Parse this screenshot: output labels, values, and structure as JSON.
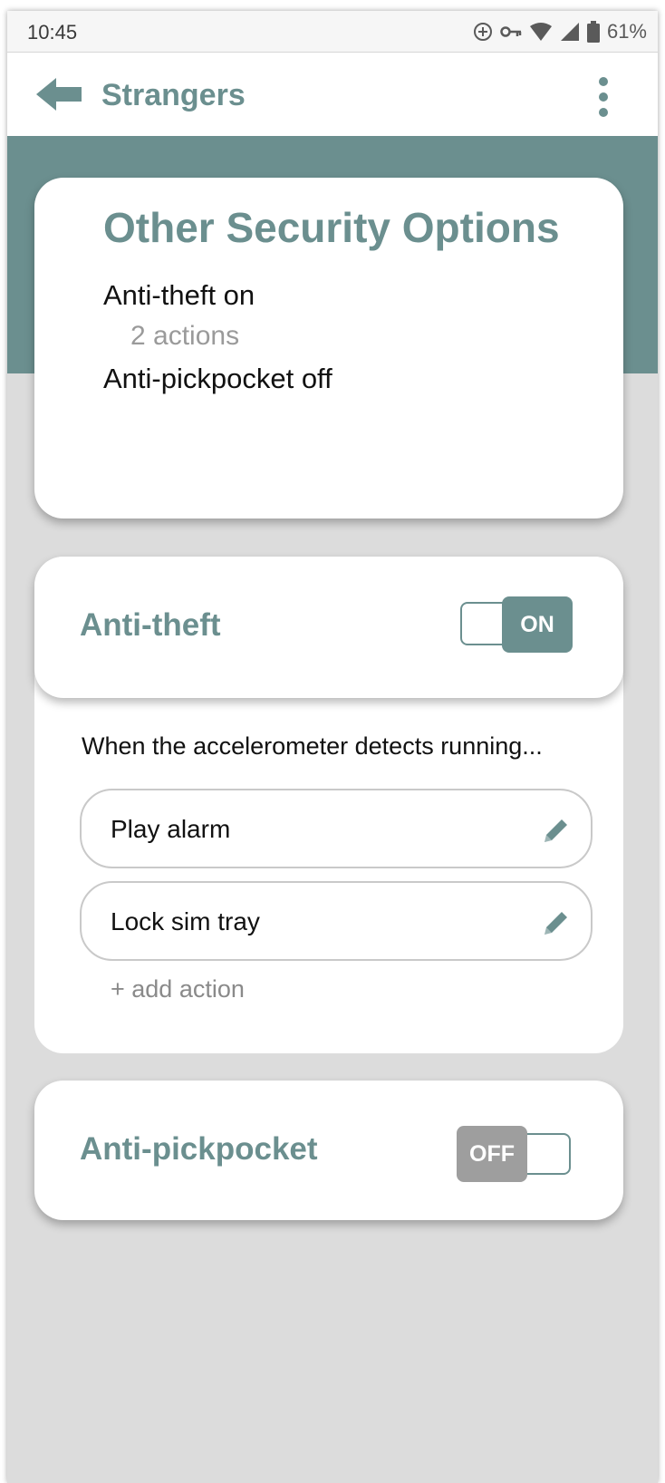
{
  "status_bar": {
    "time": "10:45",
    "battery": "61%",
    "icons": [
      "sync-icon",
      "vpn-key-icon",
      "wifi-icon",
      "cell-signal-icon",
      "battery-icon"
    ]
  },
  "app_bar": {
    "title": "Strangers",
    "back_icon": "arrow-left-icon",
    "menu_icon": "more-vert-icon"
  },
  "summary": {
    "title": "Other Security Options",
    "anti_theft_status": "Anti-theft on",
    "anti_theft_actions": "2 actions",
    "anti_pickpocket_status": "Anti-pickpocket off"
  },
  "anti_theft": {
    "title": "Anti-theft",
    "toggle_label": "ON",
    "trigger": "When the accelerometer detects running...",
    "actions": [
      {
        "label": "Play alarm"
      },
      {
        "label": "Lock sim tray"
      }
    ],
    "add_action": "+ add action"
  },
  "anti_pickpocket": {
    "title": "Anti-pickpocket",
    "toggle_label": "OFF"
  },
  "colors": {
    "accent": "#6b8f8f",
    "background": "#dcdcdc",
    "toggle_off": "#9e9e9e"
  }
}
